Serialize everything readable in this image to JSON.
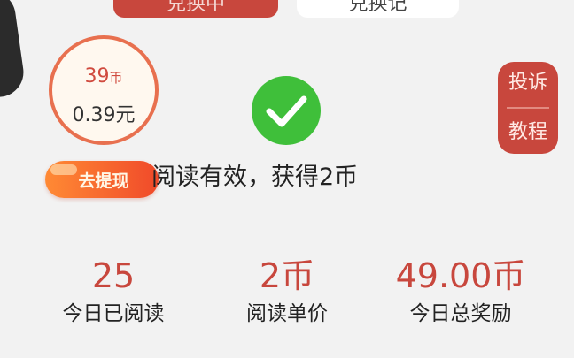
{
  "tabs": {
    "active_label": "兑换中",
    "inactive_label": "兑换记"
  },
  "coin": {
    "amount": "39",
    "unit": "币",
    "yuan": "0.39元",
    "withdraw_label": "去提现"
  },
  "message": {
    "success": "阅读有效，获得2币"
  },
  "side": {
    "complain_label": "投诉",
    "tutorial_label": "教程"
  },
  "stats": [
    {
      "value": "25",
      "label": "今日已阅读"
    },
    {
      "value": "2币",
      "label": "阅读单价"
    },
    {
      "value": "49.00币",
      "label": "今日总奖励"
    }
  ],
  "colors": {
    "accent": "#c8473d",
    "check_green": "#3fbf3a",
    "withdraw_gradient_start": "#ff8a34",
    "withdraw_gradient_end": "#f04a2a"
  }
}
